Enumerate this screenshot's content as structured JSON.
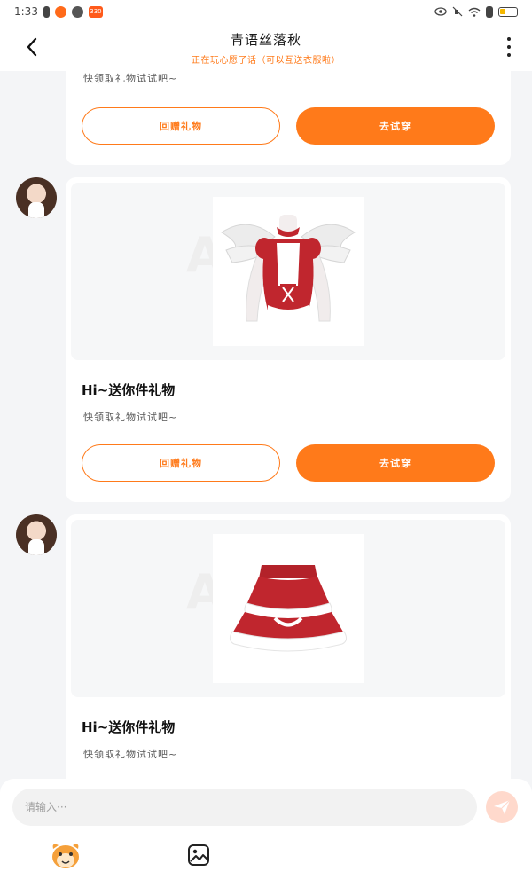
{
  "status_bar": {
    "time": "1:33",
    "app_badge": "330"
  },
  "header": {
    "title": "青语丝落秋",
    "subtitle": "正在玩心愿了话（可以互送衣服啦）"
  },
  "messages": [
    {
      "desc": "快领取礼物试试吧~",
      "return_gift_label": "回赠礼物",
      "try_on_label": "去试穿"
    },
    {
      "watermark": "A",
      "title": "Hi~送你件礼物",
      "desc": "快领取礼物试试吧~",
      "return_gift_label": "回赠礼物",
      "try_on_label": "去试穿",
      "item": "red-white-angel-top"
    },
    {
      "watermark": "A",
      "title": "Hi~送你件礼物",
      "desc": "快领取礼物试试吧~",
      "item": "red-white-ruffle-skirt"
    }
  ],
  "input": {
    "placeholder": "请输入···"
  },
  "colors": {
    "accent": "#ff7a1a",
    "background": "#f4f5f7",
    "send_disabled": "#ffd9cc"
  },
  "icons": {
    "back": "chevron-left-icon",
    "more": "more-vertical-icon",
    "send": "send-icon",
    "emoji": "mascot-emoji-icon",
    "image": "image-icon"
  }
}
